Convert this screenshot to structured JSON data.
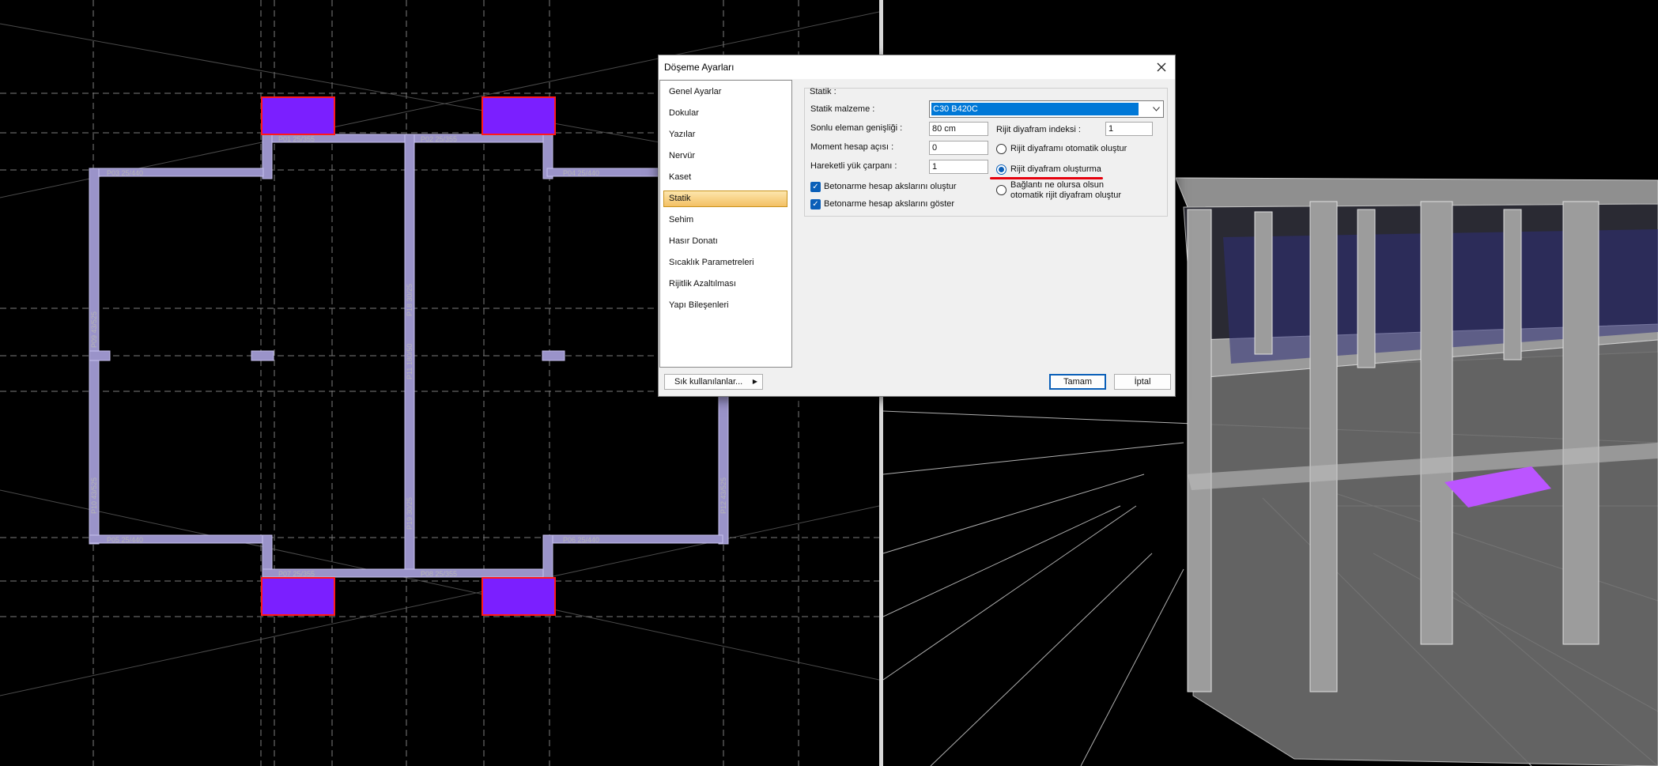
{
  "dialog": {
    "title": "Döşeme Ayarları",
    "nav_items": [
      "Genel Ayarlar",
      "Dokular",
      "Yazılar",
      "Nervür",
      "Kaset",
      "Statik",
      "Sehim",
      "Hasır Donatı",
      "Sıcaklık Parametreleri",
      "Rijitlik Azaltılması",
      "Yapı Bileşenleri"
    ],
    "selected_nav": "Statik",
    "group_title": "Statik :",
    "fields": {
      "material_label": "Statik malzeme :",
      "material_value": "C30 B420C",
      "fem_width_label": "Sonlu eleman genişliği :",
      "fem_width_value": "80 cm",
      "moment_angle_label": "Moment hesap açısı :",
      "moment_angle_value": "0",
      "moving_load_label": "Hareketli yük çarpanı :",
      "moving_load_value": "1",
      "diaphragm_index_label": "Rijit diyafram indeksi :",
      "diaphragm_index_value": "1"
    },
    "radios": {
      "auto": "Rijit diyaframı otomatik oluştur",
      "none": "Rijit diyafram oluşturma",
      "always_line1": "Bağlantı ne olursa olsun",
      "always_line2": "otomatik rijit diyafram oluştur",
      "selected": "none"
    },
    "checkboxes": {
      "create_axes": "Betonarme hesap akslarını oluştur",
      "show_axes": "Betonarme hesap akslarını göster",
      "create_checked": true,
      "show_checked": true
    },
    "buttons": {
      "favorites": "Sık kullanılanlar...",
      "ok": "Tamam",
      "cancel": "İptal"
    }
  },
  "plan": {
    "beams": [
      "P01 25/355",
      "P02 25/355",
      "P03 25/440",
      "P04 25/440",
      "P05 25/440",
      "P06 25/440",
      "P07 25/355",
      "P08 25/355",
      "P09 43/525",
      "P10 43/525",
      "P11 180/50",
      "P12 43/525",
      "P18 30/25",
      "P19 30/25"
    ]
  },
  "colors": {
    "beam": "#9a93c9",
    "column_fill": "#7b1fff",
    "column_border": "#ff1a1a",
    "model_highlight": "#bb55ff",
    "selection": "#0078d7"
  }
}
